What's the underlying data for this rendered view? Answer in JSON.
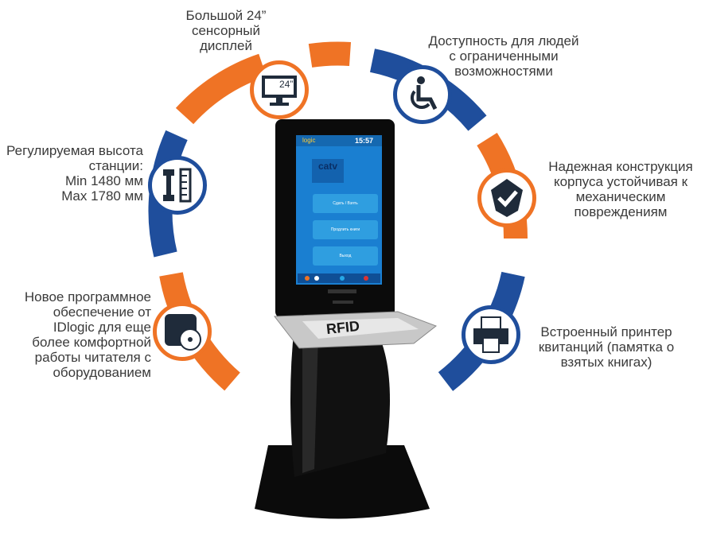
{
  "features": {
    "display": {
      "text": "Большой 24”\nсенсорный\nдисплей",
      "icon": "monitor-icon",
      "screen_label": "24”"
    },
    "accessibility": {
      "text": "Доступность для людей\nс ограниченными\nвозможностями",
      "icon": "wheelchair-icon"
    },
    "height": {
      "text": "Регулируемая высота\nстанции:\nMin 1480 мм\nMax 1780 мм",
      "icon": "height-adjust-icon"
    },
    "durability": {
      "text": "Надежная конструкция\nкорпуса устойчивая к\nмеханическим\nповреждениям",
      "icon": "shield-check-icon"
    },
    "software": {
      "text": "Новое программное\nобеспечение от\nIDlogic для еще\nболее комфортной\nработы читателя с\nоборудованием",
      "icon": "software-disc-icon"
    },
    "printer": {
      "text": "Встроенный принтер\nквитанций (памятка о\nвзятых книгах)",
      "icon": "printer-icon"
    }
  },
  "kiosk": {
    "brand": "logic",
    "logo": "catv",
    "time": "15:57",
    "buttons": [
      "Сдать / Взять",
      "Продлить книги",
      "Выход"
    ],
    "reader_label": "RFID"
  },
  "colors": {
    "orange": "#ef7325",
    "blue": "#1f4e9c",
    "screen": "#1a7fd1",
    "body": "#0c0c0c"
  }
}
